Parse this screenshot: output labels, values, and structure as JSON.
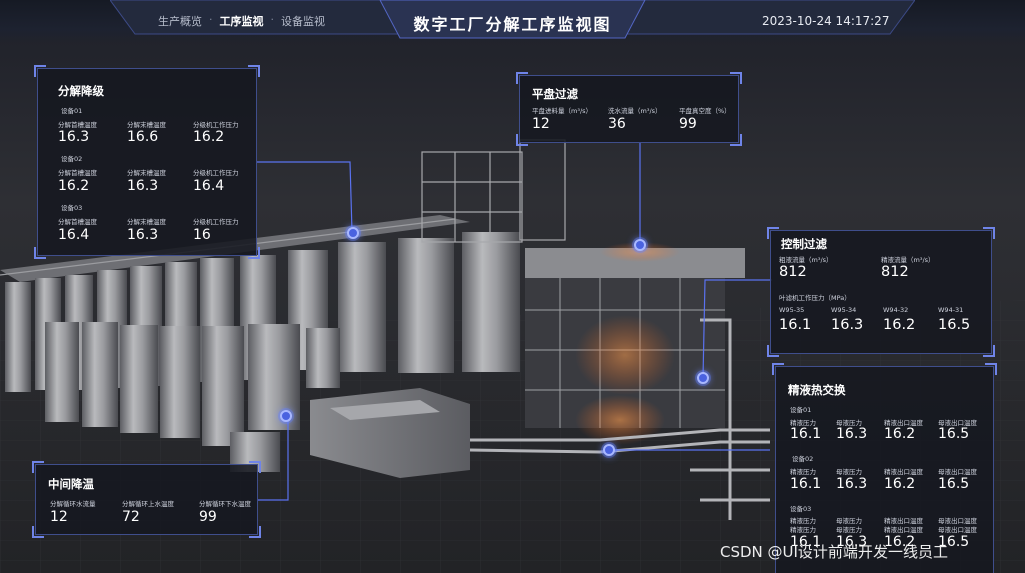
{
  "header": {
    "nav": [
      "生产概览",
      "工序监视",
      "设备监视"
    ],
    "nav_separator": "·",
    "active_nav_index": 1,
    "title": "数字工厂分解工序监视图",
    "datetime": "2023-10-24 14:17:27"
  },
  "panels": {
    "decomp": {
      "title": "分解降级",
      "devices": [
        {
          "name": "设备01",
          "labels": [
            "分解首槽温度",
            "分解末槽温度",
            "分级机工作压力"
          ],
          "values": [
            "16.3",
            "16.6",
            "16.2"
          ]
        },
        {
          "name": "设备02",
          "labels": [
            "分解首槽温度",
            "分解末槽温度",
            "分级机工作压力"
          ],
          "values": [
            "16.2",
            "16.3",
            "16.4"
          ]
        },
        {
          "name": "设备03",
          "labels": [
            "分解首槽温度",
            "分解末槽温度",
            "分级机工作压力"
          ],
          "values": [
            "16.4",
            "16.3",
            "16"
          ]
        }
      ]
    },
    "flat": {
      "title": "平盘过滤",
      "labels": [
        "平盘进料量（m³/s）",
        "洗水流量（m³/s）",
        "平盘真空度（%）"
      ],
      "values": [
        "12",
        "36",
        "99"
      ]
    },
    "control": {
      "title": "控制过滤",
      "flow_labels": [
        "粗液流量（m³/s）",
        "精液流量（m³/s）"
      ],
      "flow_values": [
        "812",
        "812"
      ],
      "pressure_title": "叶滤机工作压力（MPa）",
      "pressure_labels": [
        "W95-35",
        "W95-34",
        "W94-32",
        "W94-31"
      ],
      "pressure_values": [
        "16.1",
        "16.3",
        "16.2",
        "16.5"
      ]
    },
    "heat": {
      "title": "精液热交换",
      "devices": [
        {
          "name": "设备01",
          "labels": [
            "精液压力",
            "母液压力",
            "精液出口温度",
            "母液出口温度"
          ],
          "values": [
            "16.1",
            "16.3",
            "16.2",
            "16.5"
          ]
        },
        {
          "name": "设备02",
          "labels": [
            "精液压力",
            "母液压力",
            "精液出口温度",
            "母液出口温度"
          ],
          "values": [
            "16.1",
            "16.3",
            "16.2",
            "16.5"
          ]
        },
        {
          "name": "设备03",
          "labels": [
            "精液压力",
            "母液压力",
            "精液出口温度",
            "母液出口温度"
          ],
          "labels2": [
            "精液压力",
            "母液压力",
            "精液出口温度",
            "母液出口温度"
          ],
          "values": [
            "16.1",
            "16.3",
            "16.2",
            "16.5"
          ]
        }
      ]
    },
    "cool": {
      "title": "中间降温",
      "labels": [
        "分解循环水流量",
        "分解循环上水温度",
        "分解循环下水温度"
      ],
      "values": [
        "12",
        "72",
        "99"
      ]
    }
  },
  "watermark": "CSDN @UI设计前端开发一线员工",
  "colors": {
    "accent": "#4a62e0",
    "panel_border": "#3f4e8c",
    "background": "#2b2b2e",
    "glow": "#ff8a3a"
  }
}
